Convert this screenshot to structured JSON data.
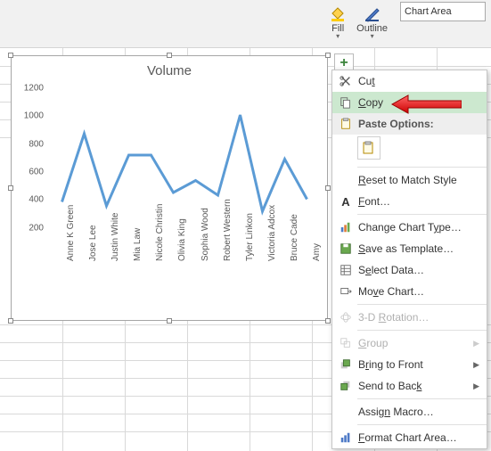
{
  "ribbon": {
    "fill_label": "Fill",
    "outline_label": "Outline",
    "chart_area_label": "Chart Area"
  },
  "chart_data": {
    "type": "line",
    "title": "Volume",
    "ylim": [
      0,
      1200
    ],
    "yticks": [
      200,
      400,
      600,
      800,
      1000,
      1200
    ],
    "categories": [
      "Anne K Green",
      "Jose Lee",
      "Justin White",
      "Mia Law",
      "Nicole Christin",
      "Olivia King",
      "Sophia Wood",
      "Robert Western",
      "Tyler Linkon",
      "Victoria Adcox",
      "Bruce Cade",
      "Amy"
    ],
    "series": [
      {
        "name": "Volume",
        "color": "#5b9bd5",
        "values": [
          350,
          860,
          320,
          700,
          700,
          420,
          510,
          400,
          1000,
          280,
          670,
          370
        ]
      }
    ]
  },
  "context_menu": {
    "cut": "Cut",
    "copy": "Copy",
    "paste_options": "Paste Options:",
    "reset": "Reset to Match Style",
    "font": "Font…",
    "change_type": "Change Chart Type…",
    "save_template": "Save as Template…",
    "select_data": "Select Data…",
    "move_chart": "Move Chart…",
    "rotation3d": "3-D Rotation…",
    "group": "Group",
    "bring_front": "Bring to Front",
    "send_back": "Send to Back",
    "assign_macro": "Assign Macro…",
    "format_area": "Format Chart Area…"
  },
  "plus_button": "+"
}
